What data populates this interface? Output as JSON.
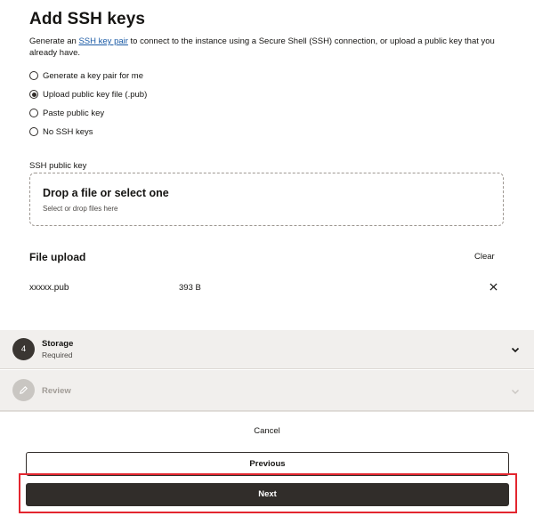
{
  "ssh": {
    "title": "Add SSH keys",
    "description_prefix": "Generate an ",
    "description_link": "SSH key pair",
    "description_suffix": " to connect to the instance using a Secure Shell (SSH) connection, or upload a public key that you already have.",
    "options": [
      {
        "label": "Generate a key pair for me",
        "selected": false
      },
      {
        "label": "Upload public key file (.pub)",
        "selected": true
      },
      {
        "label": "Paste public key",
        "selected": false
      },
      {
        "label": "No SSH keys",
        "selected": false
      }
    ],
    "field_label": "SSH public key",
    "dropzone_title": "Drop a file or select one",
    "dropzone_subtitle": "Select or drop files here",
    "upload_heading": "File upload",
    "clear_label": "Clear",
    "file_name": "xxxxx.pub",
    "file_size": "393 B",
    "remove_icon": "close-icon"
  },
  "steps": {
    "storage": {
      "number": "4",
      "title": "Storage",
      "subtitle": "Required",
      "icon": "chevron-down-icon"
    },
    "review": {
      "title": "Review",
      "icon": "pencil-icon"
    }
  },
  "footer": {
    "cancel_label": "Cancel",
    "previous_label": "Previous",
    "next_label": "Next",
    "highlight_color": "#e3262f"
  }
}
